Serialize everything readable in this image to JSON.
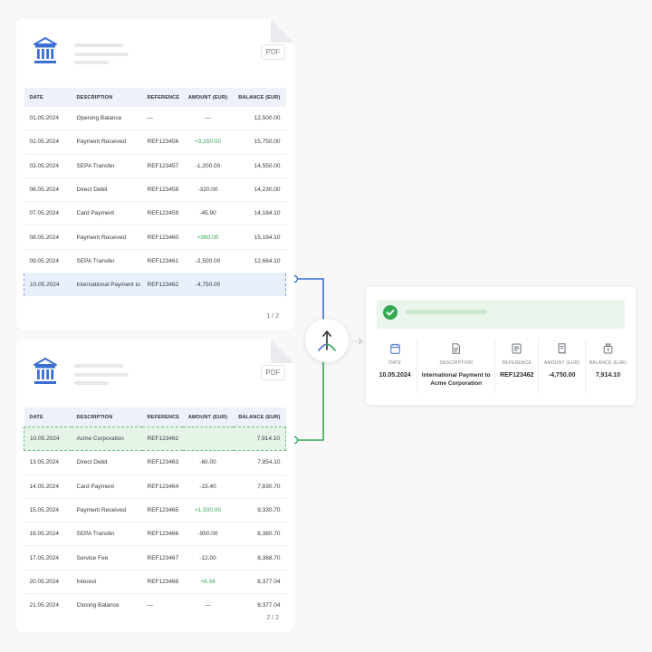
{
  "colors": {
    "accent_blue": "#3b6fd4",
    "accent_green": "#34a853",
    "highlight_blue": "#e8f0fc",
    "highlight_green": "#e6f4e8"
  },
  "icons": {
    "bank": "bank-icon",
    "merge": "merge-arrow-icon",
    "check": "check-icon",
    "date": "calendar-icon",
    "description": "document-icon",
    "reference": "receipt-icon",
    "amount": "invoice-icon",
    "balance": "wallet-icon"
  },
  "doc1": {
    "pdf_badge": "PDF",
    "headers": {
      "date": "DATE",
      "description": "DESCRIPTION",
      "reference": "REFERENCE",
      "amount": "AMOUNT (EUR)",
      "balance": "BALANCE (EUR)"
    },
    "rows": [
      {
        "date": "01.05.2024",
        "description": "Opening Balance",
        "reference": "—",
        "amount": "—",
        "balance": "12,500.00"
      },
      {
        "date": "02.05.2024",
        "description": "Payment Received",
        "reference": "REF123456",
        "amount": "+3,250.00",
        "balance": "15,750.00"
      },
      {
        "date": "03.05.2024",
        "description": "SEPA Transfer",
        "reference": "REF123457",
        "amount": "-1,200.00",
        "balance": "14,550.00"
      },
      {
        "date": "06.05.2024",
        "description": "Direct Debit",
        "reference": "REF123458",
        "amount": "-320.00",
        "balance": "14,230.00"
      },
      {
        "date": "07.05.2024",
        "description": "Card Payment",
        "reference": "REF123459",
        "amount": "-45.90",
        "balance": "14,184.10"
      },
      {
        "date": "08.05.2024",
        "description": "Payment Received",
        "reference": "REF123460",
        "amount": "+980.00",
        "balance": "15,164.10"
      },
      {
        "date": "09.05.2024",
        "description": "SEPA Transfer",
        "reference": "REF123461",
        "amount": "-2,500.00",
        "balance": "12,664.10"
      },
      {
        "date": "10.05.2024",
        "description": "International Payment to",
        "reference": "REF123462",
        "amount": "-4,750.00",
        "balance": ""
      }
    ],
    "page_label": "1 / 2"
  },
  "doc2": {
    "pdf_badge": "PDF",
    "headers": {
      "date": "DATE",
      "description": "DESCRIPTION",
      "reference": "REFERENCE",
      "amount": "AMOUNT (EUR)",
      "balance": "BALANCE (EUR)"
    },
    "rows": [
      {
        "date": "10.05.2024",
        "description": "Acme Corporation",
        "reference": "REF123462",
        "amount": "",
        "balance": "7,914.10"
      },
      {
        "date": "13.05.2024",
        "description": "Direct Debit",
        "reference": "REF123463",
        "amount": "-60.00",
        "balance": "7,854.10"
      },
      {
        "date": "14.05.2024",
        "description": "Card Payment",
        "reference": "REF123464",
        "amount": "-23.40",
        "balance": "7,830.70"
      },
      {
        "date": "15.05.2024",
        "description": "Payment Received",
        "reference": "REF123465",
        "amount": "+1,500.00",
        "balance": "9,330.70"
      },
      {
        "date": "16.05.2024",
        "description": "SEPA Transfer",
        "reference": "REF123466",
        "amount": "-950.00",
        "balance": "8,380.70"
      },
      {
        "date": "17.05.2024",
        "description": "Service Fee",
        "reference": "REF123467",
        "amount": "-12.00",
        "balance": "8,368.70"
      },
      {
        "date": "20.05.2024",
        "description": "Interest",
        "reference": "REF123468",
        "amount": "+8.34",
        "balance": "8,377.04"
      },
      {
        "date": "21.05.2024",
        "description": "Closing Balance",
        "reference": "—",
        "amount": "—",
        "balance": "8,377.04"
      }
    ],
    "page_label": "2 / 2"
  },
  "result": {
    "fields": [
      {
        "label": "DATE",
        "value": "10.05.2024"
      },
      {
        "label": "DESCRIPTION",
        "value": "International Payment to Acme Corporation"
      },
      {
        "label": "REFERENCE",
        "value": "REF123462"
      },
      {
        "label": "AMOUNT (EUR)",
        "value": "-4,750.00"
      },
      {
        "label": "BALANCE (EUR)",
        "value": "7,914.10"
      }
    ]
  }
}
